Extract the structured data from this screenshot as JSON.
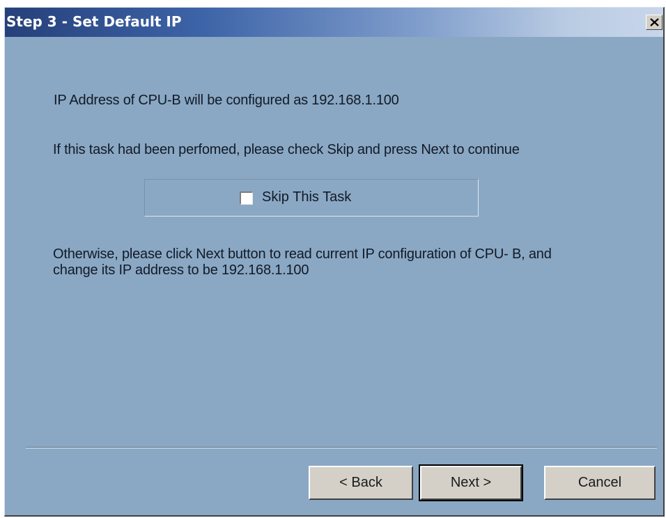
{
  "window": {
    "title": "Step 3 - Set Default IP",
    "close_label": "×"
  },
  "content": {
    "line1": "IP Address of CPU-B will be configured as 192.168.1.100",
    "para2": "If this task had been perfomed, please check Skip and press Next to continue",
    "skip_checkbox_label": "Skip This Task",
    "skip_checked": false,
    "para3": "Otherwise, please click Next button to read current IP configuration of CPU- B, and change its IP address to be 192.168.1.100"
  },
  "buttons": {
    "back": "< Back",
    "next": "Next >",
    "cancel": "Cancel"
  },
  "colors": {
    "dialog_background": "#8aa8c4",
    "title_gradient_start": "#26407a",
    "title_gradient_end": "#c8d6ea",
    "button_face": "#d4d0c8"
  }
}
